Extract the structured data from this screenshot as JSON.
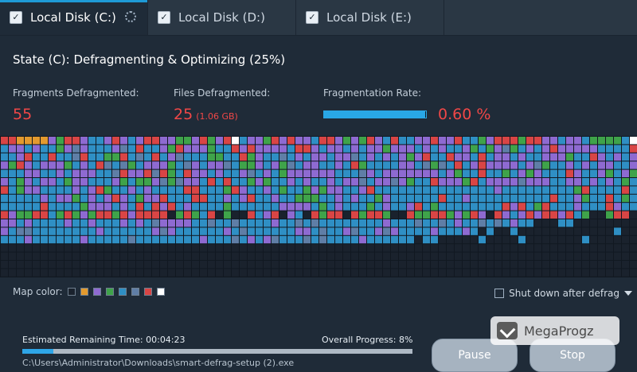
{
  "tabs": [
    {
      "label": "Local Disk (C:)",
      "checked": true,
      "active": true
    },
    {
      "label": "Local Disk (D:)",
      "checked": true,
      "active": false
    },
    {
      "label": "Local Disk (E:)",
      "checked": true,
      "active": false
    }
  ],
  "state_text": "State (C): Defragmenting & Optimizing (25%)",
  "metrics": {
    "fragments_label": "Fragments Defragmented:",
    "fragments_value": "55",
    "files_label": "Files Defragmented:",
    "files_value": "25",
    "files_size": "(1.06 GB)",
    "rate_label": "Fragmentation Rate:",
    "rate_value": "0.60 %",
    "rate_bar_fraction": 0.99
  },
  "map": {
    "colors": [
      "#1a222d",
      "#e39a2e",
      "#8e6ad1",
      "#3fa34a",
      "#2f8fc4",
      "#5f7ea6",
      "#d94545",
      "#ffffff"
    ],
    "legend_label": "Map color:"
  },
  "shutdown_label": "Shut down after defrag",
  "progress": {
    "eta_label": "Estimated Remaining Time:",
    "eta_value": "00:04:23",
    "overall_label": "Overall Progress:",
    "overall_value": "8%",
    "overall_fraction": 0.08,
    "path": "C:\\Users\\Administrator\\Downloads\\smart-defrag-setup (2).exe"
  },
  "buttons": {
    "pause": "Pause",
    "stop": "Stop"
  },
  "watermark": "MegaProgz"
}
